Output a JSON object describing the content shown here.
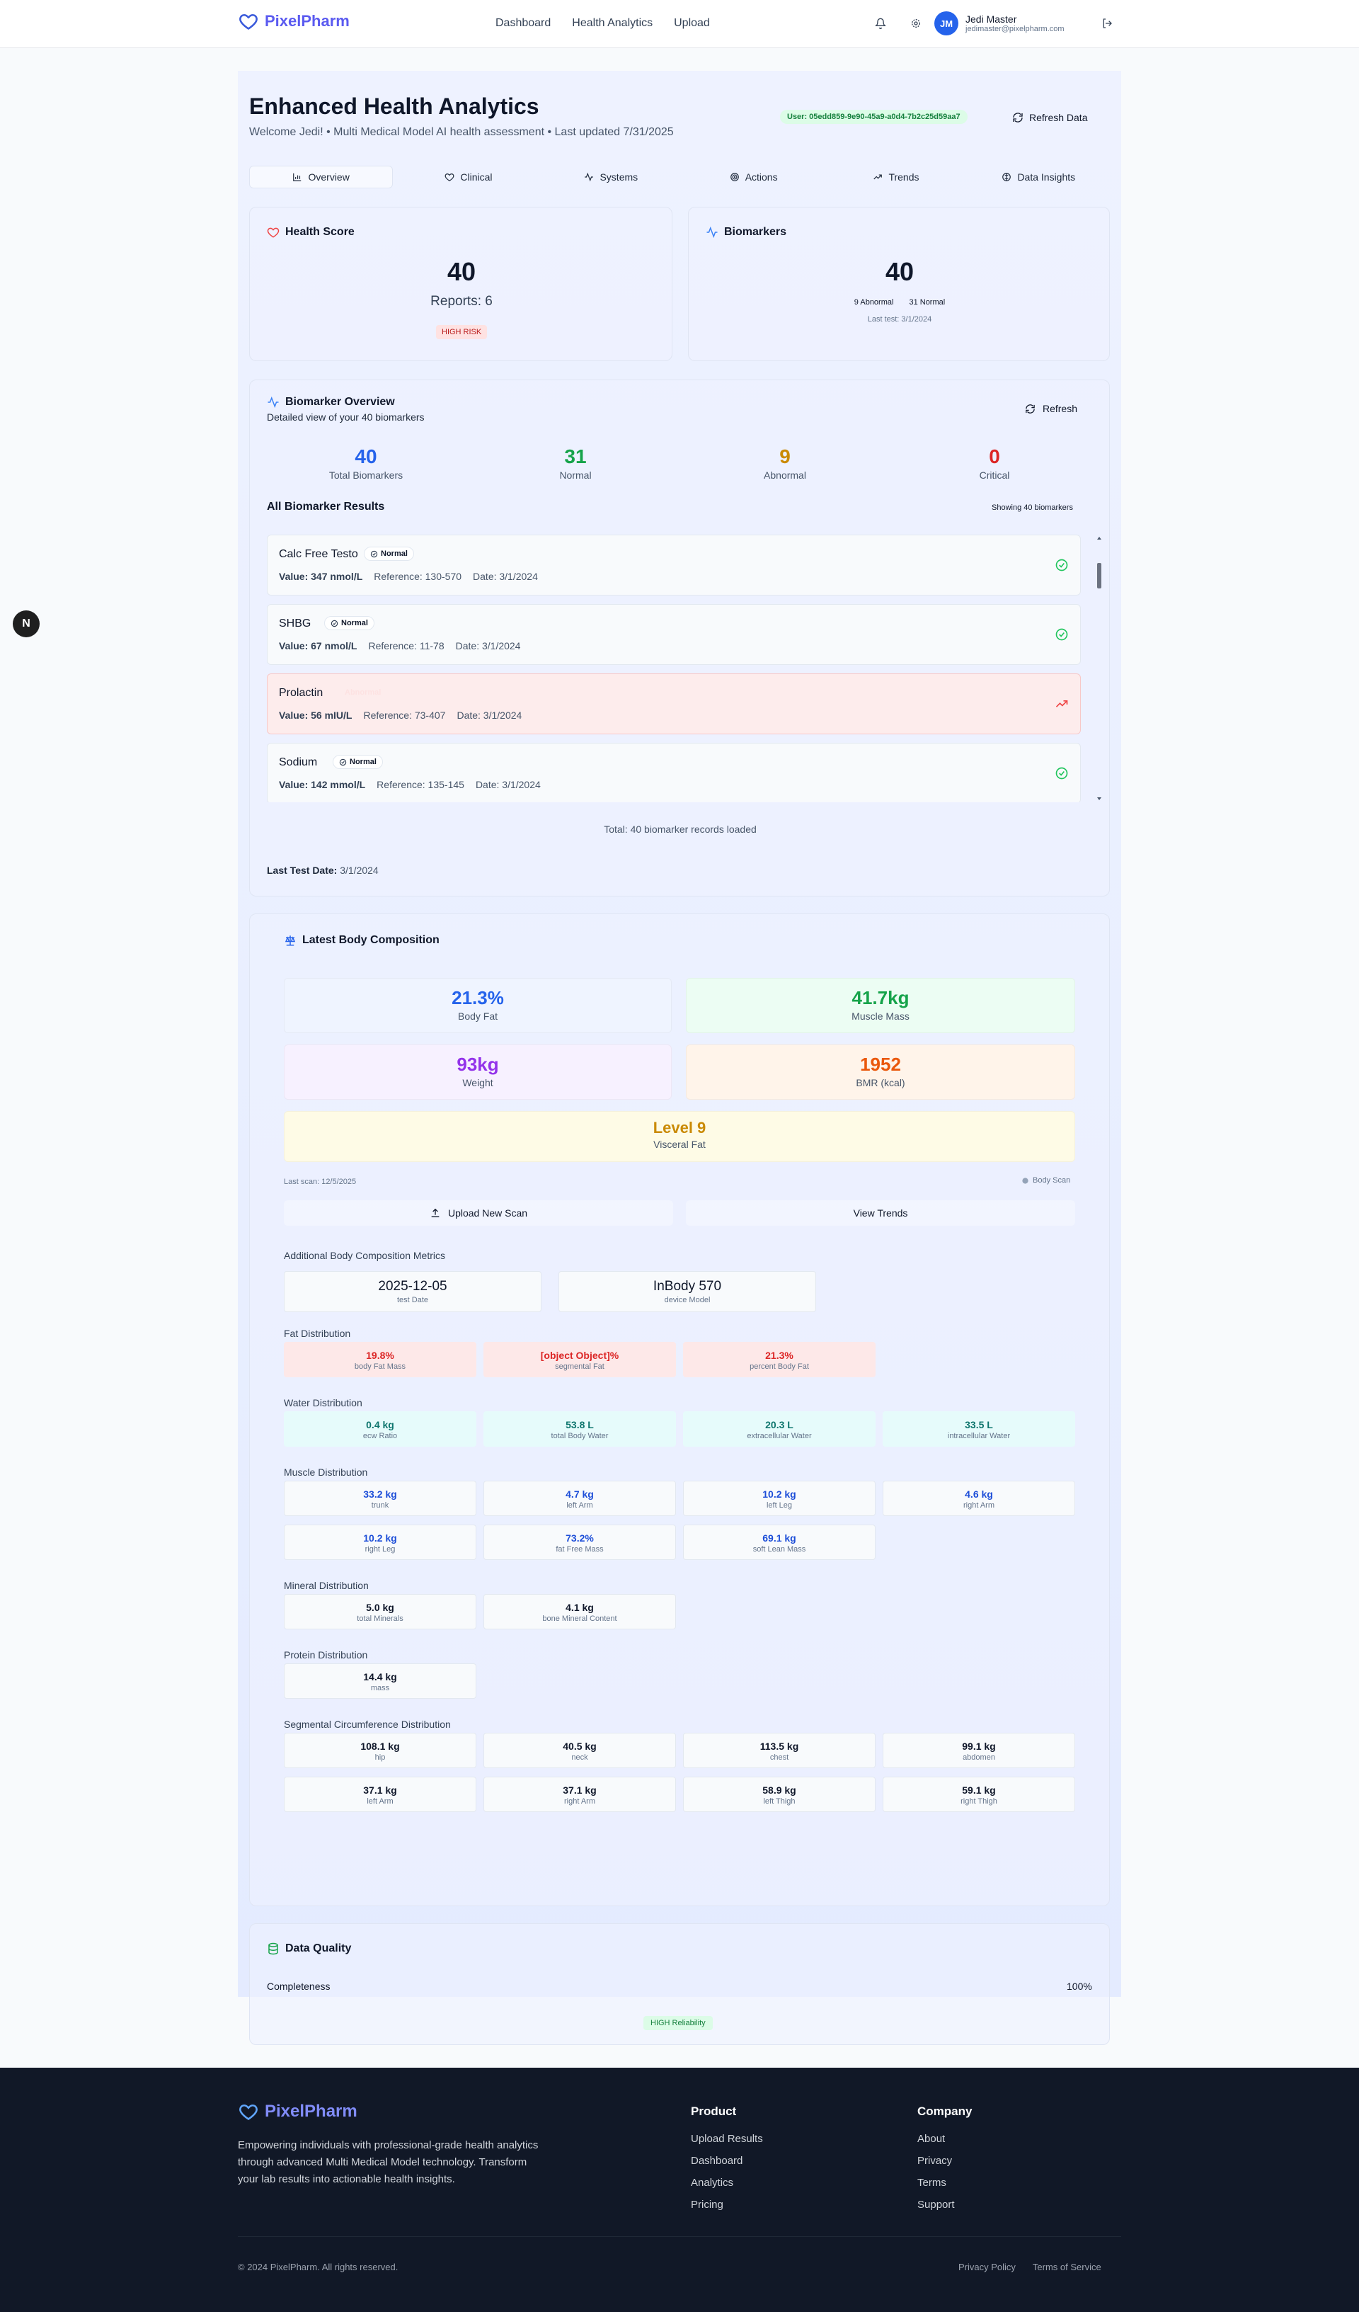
{
  "header": {
    "brand": "PixelPharm",
    "nav": [
      "Dashboard",
      "Health Analytics",
      "Upload"
    ],
    "user": {
      "initials": "JM",
      "name": "Jedi Master",
      "email": "jedimaster@pixelpharm.com"
    }
  },
  "page": {
    "title": "Enhanced Health Analytics",
    "subtitle": "Welcome Jedi! • Multi Medical Model AI health assessment • Last updated 7/31/2025",
    "user_badge": "User: 05edd859-9e90-45a9-a0d4-7b2c25d59aa7",
    "refresh_button": "Refresh Data",
    "tabs": [
      "Overview",
      "Clinical",
      "Systems",
      "Actions",
      "Trends",
      "Data Insights"
    ]
  },
  "health_score": {
    "title": "Health Score",
    "value": "40",
    "reports": "Reports: 6",
    "risk": "HIGH RISK"
  },
  "biomarkers_card": {
    "title": "Biomarkers",
    "value": "40",
    "abnormal": "9 Abnormal",
    "normal": "31 Normal",
    "last_test": "Last test: 3/1/2024"
  },
  "overview": {
    "title": "Biomarker Overview",
    "subtitle": "Detailed view of your 40 biomarkers",
    "refresh": "Refresh",
    "stats": [
      {
        "value": "40",
        "label": "Total Biomarkers",
        "color": "#2563eb"
      },
      {
        "value": "31",
        "label": "Normal",
        "color": "#16a34a"
      },
      {
        "value": "9",
        "label": "Abnormal",
        "color": "#ca8a04"
      },
      {
        "value": "0",
        "label": "Critical",
        "color": "#dc2626"
      }
    ],
    "list_title": "All Biomarker Results",
    "showing": "Showing 40 biomarkers",
    "items": [
      {
        "name": "Calc Free Testo",
        "status": "Normal",
        "value": "Value: 347 nmol/L",
        "reference": "Reference: 130-570",
        "date": "Date: 3/1/2024"
      },
      {
        "name": "SHBG",
        "status": "Normal",
        "value": "Value: 67 nmol/L",
        "reference": "Reference: 11-78",
        "date": "Date: 3/1/2024"
      },
      {
        "name": "Prolactin",
        "status": "Abnormal",
        "value": "Value: 56 mIU/L",
        "reference": "Reference: 73-407",
        "date": "Date: 3/1/2024"
      },
      {
        "name": "Sodium",
        "status": "Normal",
        "value": "Value: 142 mmol/L",
        "reference": "Reference: 135-145",
        "date": "Date: 3/1/2024"
      }
    ],
    "total": "Total: 40 biomarker records loaded",
    "last_test_label": "Last Test Date:",
    "last_test_value": "3/1/2024"
  },
  "body_comp": {
    "title": "Latest Body Composition",
    "metrics": [
      {
        "value": "21.3%",
        "label": "Body Fat",
        "color": "#2563eb",
        "bg": "#eff4ff"
      },
      {
        "value": "41.7kg",
        "label": "Muscle Mass",
        "color": "#16a34a",
        "bg": "#ecfdf3"
      },
      {
        "value": "93kg",
        "label": "Weight",
        "color": "#9333ea",
        "bg": "#f7f1ff"
      },
      {
        "value": "1952",
        "label": "BMR (kcal)",
        "color": "#ea580c",
        "bg": "#fff4ea"
      }
    ],
    "visceral": {
      "value": "Level 9",
      "label": "Visceral Fat",
      "color": "#ca8a04",
      "bg": "#fefbe6"
    },
    "last_scan": "Last scan: 12/5/2025",
    "scan_type": "Body Scan",
    "upload_btn": "Upload New Scan",
    "trends_btn": "View Trends",
    "additional_title": "Additional Body Composition Metrics",
    "additional": [
      {
        "value": "2025-12-05",
        "label": "test Date"
      },
      {
        "value": "InBody 570",
        "label": "device Model"
      }
    ],
    "fat_title": "Fat Distribution",
    "fat": [
      {
        "value": "19.8%",
        "label": "body Fat Mass"
      },
      {
        "value": "[object Object]%",
        "label": "segmental Fat"
      },
      {
        "value": "21.3%",
        "label": "percent Body Fat"
      }
    ],
    "water_title": "Water Distribution",
    "water": [
      {
        "value": "0.4 kg",
        "label": "ecw Ratio"
      },
      {
        "value": "53.8 L",
        "label": "total Body Water"
      },
      {
        "value": "20.3 L",
        "label": "extracellular Water"
      },
      {
        "value": "33.5 L",
        "label": "intracellular Water"
      }
    ],
    "muscle_title": "Muscle Distribution",
    "muscle": [
      {
        "value": "33.2 kg",
        "label": "trunk"
      },
      {
        "value": "4.7 kg",
        "label": "left Arm"
      },
      {
        "value": "10.2 kg",
        "label": "left Leg"
      },
      {
        "value": "4.6 kg",
        "label": "right Arm"
      },
      {
        "value": "10.2 kg",
        "label": "right Leg"
      },
      {
        "value": "73.2%",
        "label": "fat Free Mass"
      },
      {
        "value": "69.1 kg",
        "label": "soft Lean Mass"
      }
    ],
    "mineral_title": "Mineral Distribution",
    "mineral": [
      {
        "value": "5.0 kg",
        "label": "total Minerals"
      },
      {
        "value": "4.1 kg",
        "label": "bone Mineral Content"
      }
    ],
    "protein_title": "Protein Distribution",
    "protein": [
      {
        "value": "14.4 kg",
        "label": "mass"
      }
    ],
    "circ_title": "Segmental Circumference Distribution",
    "circ": [
      {
        "value": "108.1 kg",
        "label": "hip"
      },
      {
        "value": "40.5 kg",
        "label": "neck"
      },
      {
        "value": "113.5 kg",
        "label": "chest"
      },
      {
        "value": "99.1 kg",
        "label": "abdomen"
      },
      {
        "value": "37.1 kg",
        "label": "left Arm"
      },
      {
        "value": "37.1 kg",
        "label": "right Arm"
      },
      {
        "value": "58.9 kg",
        "label": "left Thigh"
      },
      {
        "value": "59.1 kg",
        "label": "right Thigh"
      }
    ]
  },
  "data_quality": {
    "title": "Data Quality",
    "completeness_label": "Completeness",
    "completeness_value": "100%",
    "reliability": "HIGH Reliability"
  },
  "footer": {
    "brand": "PixelPharm",
    "description": "Empowering individuals with professional-grade health analytics through advanced Multi Medical Model technology. Transform your lab results into actionable health insights.",
    "product_title": "Product",
    "product": [
      "Upload Results",
      "Dashboard",
      "Analytics",
      "Pricing"
    ],
    "company_title": "Company",
    "company": [
      "About",
      "Privacy",
      "Terms",
      "Support"
    ],
    "copyright": "© 2024 PixelPharm. All rights reserved.",
    "links": [
      "Privacy Policy",
      "Terms of Service"
    ]
  },
  "dev_badge": "N"
}
